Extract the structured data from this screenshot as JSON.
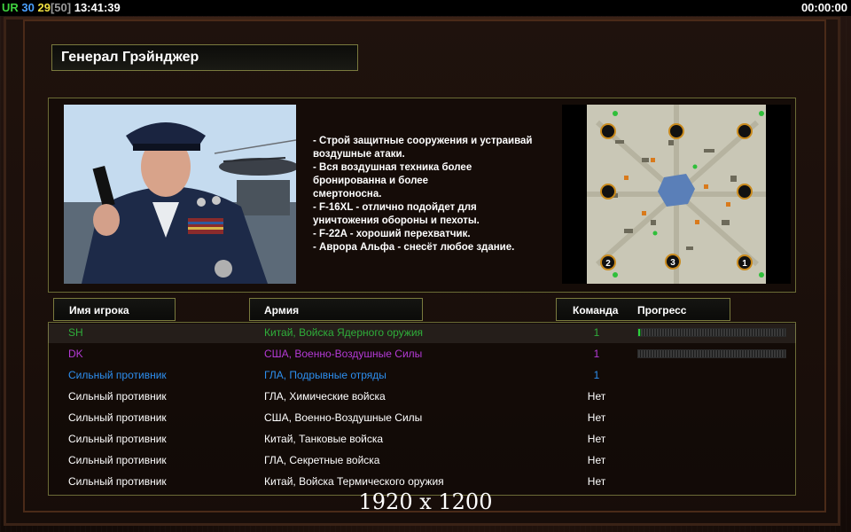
{
  "topbar": {
    "ur_label": "UR",
    "fps": "30",
    "logic": "29",
    "logic_cap": "[50]",
    "clock": "13:41:39",
    "timer": "00:00:00"
  },
  "general": {
    "name": "Генерал Грэйнджер"
  },
  "description": [
    "- Строй защитные сооружения и устраивай",
    " воздушные атаки.",
    "- Вся воздушная техника более",
    " бронированна и более",
    "смертоносна.",
    "- F-16XL - отлично подойдет для",
    " уничтожения обороны и пехоты.",
    "- F-22A - хороший перехватчик.",
    "- Аврора Альфа - снесёт любое здание."
  ],
  "map": {
    "start_labels": [
      "2",
      "3",
      "1"
    ]
  },
  "headers": {
    "player_name": "Имя игрока",
    "army": "Армия",
    "team": "Команда",
    "progress": "Прогресс"
  },
  "players": [
    {
      "name": "SH",
      "army": "Китай, Войска Ядерного оружия",
      "team": "1",
      "progress": 0.02,
      "color": "#2fae3a",
      "show_progress": true
    },
    {
      "name": "DK",
      "army": "США, Военно-Воздушные Силы",
      "team": "1",
      "progress": 0.0,
      "color": "#b43ad6",
      "show_progress": true
    },
    {
      "name": "Сильный противник",
      "army": "ГЛА, Подрывные отряды",
      "team": "1",
      "progress": 0.0,
      "color": "#2d8ff0",
      "show_progress": false
    },
    {
      "name": "Сильный противник",
      "army": "ГЛА, Химические войска",
      "team": "Нет",
      "progress": 0.0,
      "color": "#ffffff",
      "show_progress": false
    },
    {
      "name": "Сильный противник",
      "army": "США, Военно-Воздушные Силы",
      "team": "Нет",
      "progress": 0.0,
      "color": "#ffffff",
      "show_progress": false
    },
    {
      "name": "Сильный противник",
      "army": "Китай, Танковые войска",
      "team": "Нет",
      "progress": 0.0,
      "color": "#ffffff",
      "show_progress": false
    },
    {
      "name": "Сильный противник",
      "army": "ГЛА, Секретные войска",
      "team": "Нет",
      "progress": 0.0,
      "color": "#ffffff",
      "show_progress": false
    },
    {
      "name": "Сильный противник",
      "army": "Китай, Войска Термического оружия",
      "team": "Нет",
      "progress": 0.0,
      "color": "#ffffff",
      "show_progress": false
    }
  ],
  "resolution": "1920 x 1200",
  "colors": {
    "ur": "#3fd13f",
    "fps": "#4aa0ff",
    "logic": "#f0e040",
    "logic_cap": "#9a9a9a",
    "frame_accent": "#7a7a3e"
  }
}
